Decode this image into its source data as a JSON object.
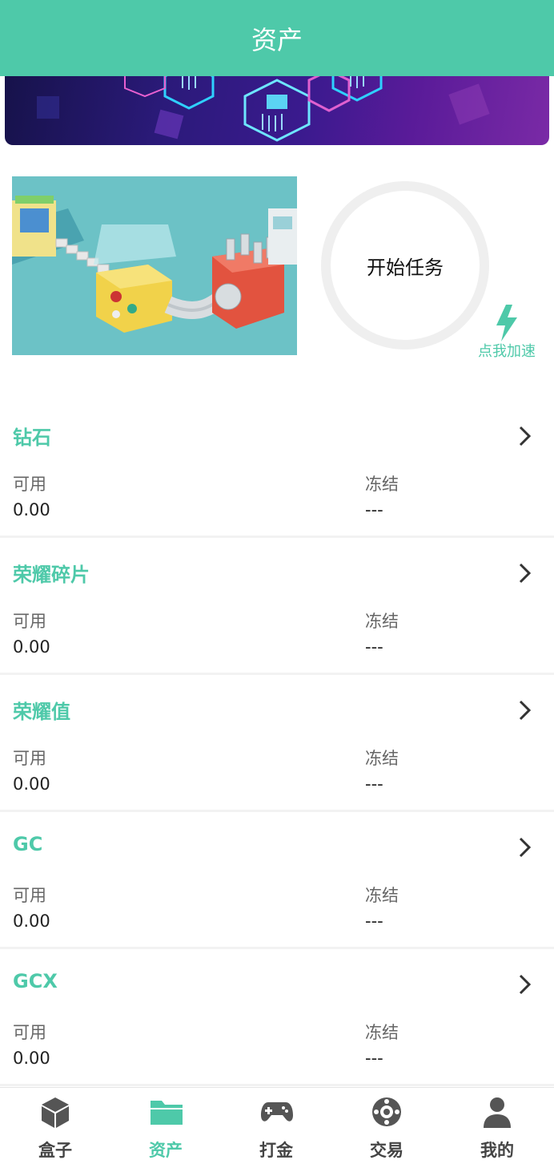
{
  "header": {
    "title": "资产"
  },
  "task": {
    "start_label": "开始任务",
    "boost_label": "点我加速"
  },
  "assets": [
    {
      "name": "钻石",
      "available_label": "可用",
      "available": "0.00",
      "frozen_label": "冻结",
      "frozen": "---"
    },
    {
      "name": "荣耀碎片",
      "available_label": "可用",
      "available": "0.00",
      "frozen_label": "冻结",
      "frozen": "---"
    },
    {
      "name": "荣耀值",
      "available_label": "可用",
      "available": "0.00",
      "frozen_label": "冻结",
      "frozen": "---"
    },
    {
      "name": "GC",
      "available_label": "可用",
      "available": "0.00",
      "frozen_label": "冻结",
      "frozen": "---"
    },
    {
      "name": "GCX",
      "available_label": "可用",
      "available": "0.00",
      "frozen_label": "冻结",
      "frozen": "---"
    }
  ],
  "tabs": [
    {
      "label": "盒子",
      "icon": "box-icon"
    },
    {
      "label": "资产",
      "icon": "folder-icon",
      "active": true
    },
    {
      "label": "打金",
      "icon": "gamepad-icon"
    },
    {
      "label": "交易",
      "icon": "exchange-icon"
    },
    {
      "label": "我的",
      "icon": "user-icon"
    }
  ],
  "colors": {
    "accent": "#4ec9a9",
    "header_bg": "#4ec9a9",
    "tab_inactive": "#444444"
  }
}
